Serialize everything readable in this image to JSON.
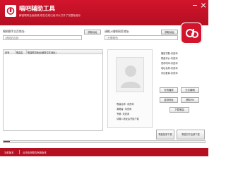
{
  "app": {
    "title": "唱吧辅助工具",
    "subtitle": "解锁唱吧全面音频,现在在线已经可以打开了完整版音乐",
    "logo_icon": "changba-logo-icon",
    "accent_color": "#d2142c"
  },
  "window_controls": {
    "minimize_icon": "minimize-icon",
    "close_icon": "close-icon"
  },
  "song_url": {
    "label": "唱吧歌手主页地址:",
    "placeholder": "(请粘贴合适)",
    "parse_button": "获取地址"
  },
  "page_url": {
    "label": "请输入唱吧网页地址:",
    "placeholder": "(无需唱吧)",
    "parse_button": "获取地址"
  },
  "song_list": {
    "columns": [
      "序号",
      "歌曲名",
      "歌曲歌词地址(解析文件地址)"
    ],
    "rows": []
  },
  "profile": {
    "photo_icon": "avatar-placeholder-icon",
    "song_line": "歌曲名称: 未查询",
    "singer_line": "演唱者: 未查询",
    "album_line": "专辑: 未查询",
    "download_line": "请输入地址后开始下载"
  },
  "info": {
    "lines": [
      {
        "label": "播放次数:",
        "value": "未查询"
      },
      {
        "label": "歌曲评价:",
        "value": "未查询"
      },
      {
        "label": "发布时间:",
        "value": "未查询"
      },
      {
        "label": "地址名称:",
        "value": "未查询"
      },
      {
        "label": "评论数量:",
        "value": "未查询"
      }
    ]
  },
  "actions": {
    "play": "在线播放",
    "lyrics": "无法编辑",
    "copy_url": "复制地址",
    "save_mv": "获取MV",
    "download": "下载歌曲",
    "batch_download": "歌曲批量下载",
    "download_all": "歌曲打开全部下载"
  },
  "progress": {
    "value": 0.03
  },
  "footer": {
    "version": "当前版本",
    "link": "点击检测是否有新版本"
  }
}
